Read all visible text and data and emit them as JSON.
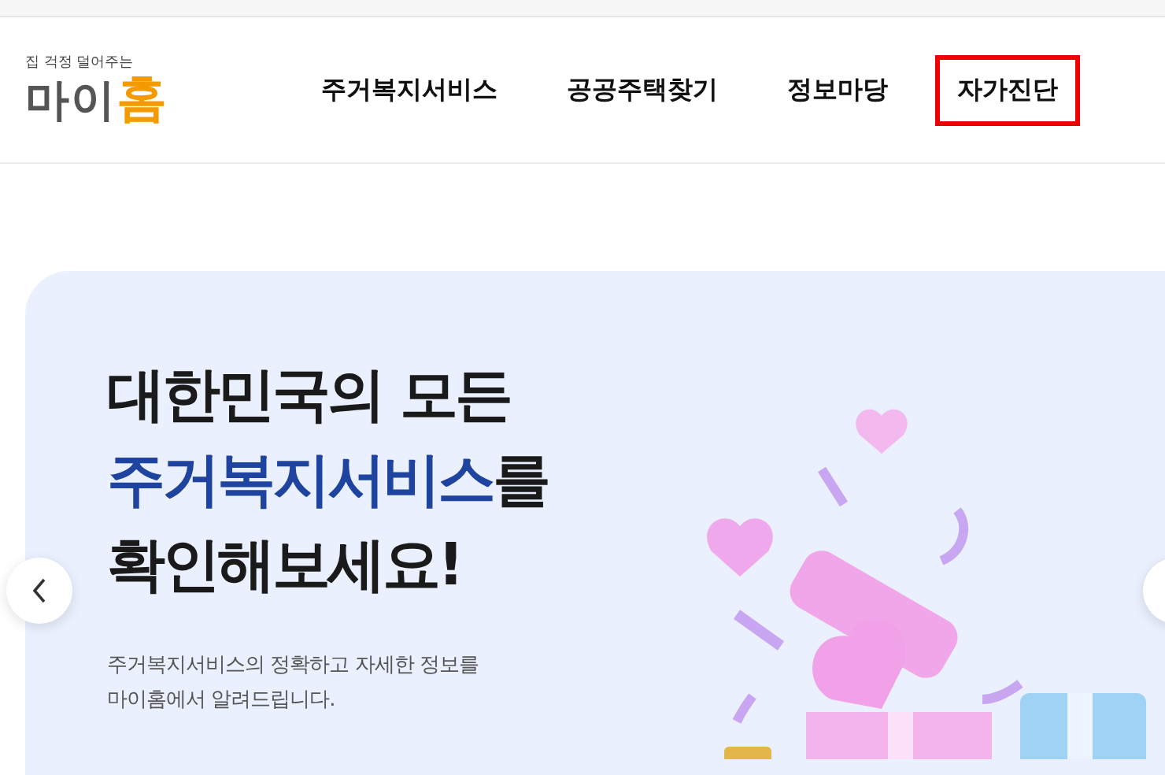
{
  "logo": {
    "tagline": "집 걱정 덜어주는",
    "name_main": "마이",
    "name_accent": "홈"
  },
  "nav": [
    {
      "label": "주거복지서비스",
      "selected": false
    },
    {
      "label": "공공주택찾기",
      "selected": false
    },
    {
      "label": "정보마당",
      "selected": false
    },
    {
      "label": "자가진단",
      "selected": true
    }
  ],
  "hero": {
    "headline": [
      [
        {
          "text": "대한민국의 모든",
          "accent": false
        }
      ],
      [
        {
          "text": "주거복지서비스",
          "accent": true
        },
        {
          "text": "를",
          "accent": false
        }
      ],
      [
        {
          "text": "확인해보세요!",
          "accent": false
        }
      ]
    ],
    "description": [
      "주거복지서비스의 정확하고 자세한 정보를",
      "마이홈에서 알려드립니다."
    ]
  }
}
